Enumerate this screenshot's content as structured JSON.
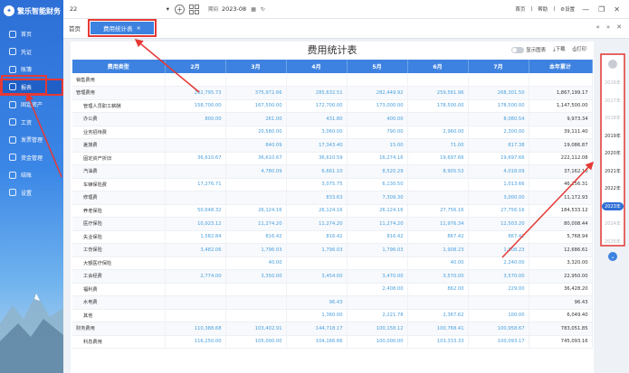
{
  "brand": {
    "name": "繁乐智能财务"
  },
  "sidebar": {
    "items": [
      {
        "label": "首页",
        "icon": "home-icon"
      },
      {
        "label": "凭证",
        "icon": "voucher-icon"
      },
      {
        "label": "账簿",
        "icon": "ledger-icon"
      },
      {
        "label": "报表",
        "icon": "report-icon"
      },
      {
        "label": "固定资产",
        "icon": "asset-icon"
      },
      {
        "label": "工资",
        "icon": "salary-icon"
      },
      {
        "label": "发票管理",
        "icon": "invoice-icon"
      },
      {
        "label": "资金管理",
        "icon": "fund-icon"
      },
      {
        "label": "结账",
        "icon": "close-books-icon"
      },
      {
        "label": "设置",
        "icon": "settings-icon"
      }
    ],
    "active_index": 3
  },
  "topbar": {
    "account": "22",
    "period_label": "期间",
    "period_value": "2023-08",
    "links": [
      "首页",
      "帮助",
      "设置"
    ]
  },
  "tabs": {
    "home": "首页",
    "active": "费用统计表",
    "close": "×"
  },
  "report": {
    "title": "费用统计表",
    "show_chart": "显示图表",
    "download": "下载",
    "print": "打印",
    "headers": [
      "费用类型",
      "2月",
      "3月",
      "4月",
      "5月",
      "6月",
      "7月",
      "本年累计"
    ],
    "rows": [
      {
        "name": "销售费用",
        "child": false,
        "cells": [
          "",
          "",
          "",
          "",
          "",
          "",
          ""
        ]
      },
      {
        "name": "管理费用",
        "child": false,
        "cells": [
          "262,795.73",
          "375,972.66",
          "285,632.51",
          "282,449.92",
          "259,561.96",
          "268,301.50",
          "1,867,199.17"
        ]
      },
      {
        "name": "管理人员职工薪酬",
        "child": true,
        "cells": [
          "158,700.00",
          "167,500.00",
          "172,700.00",
          "173,000.00",
          "178,500.00",
          "178,500.00",
          "1,147,500.00"
        ]
      },
      {
        "name": "办公费",
        "child": true,
        "cells": [
          "800.00",
          "261.00",
          "431.80",
          "400.00",
          "",
          "8,080.54",
          "9,973.34"
        ]
      },
      {
        "name": "业务招待费",
        "child": true,
        "cells": [
          "",
          "20,580.00",
          "3,060.00",
          "790.00",
          "2,960.00",
          "2,300.00",
          "39,111.40"
        ]
      },
      {
        "name": "差旅费",
        "child": true,
        "cells": [
          "",
          "840.09",
          "17,343.40",
          "15.00",
          "71.00",
          "817.38",
          "19,086.87"
        ]
      },
      {
        "name": "固定资产折旧",
        "child": true,
        "cells": [
          "36,610.67",
          "36,610.67",
          "36,610.59",
          "16,274.16",
          "19,697.66",
          "19,697.66",
          "222,112.08"
        ]
      },
      {
        "name": "汽油费",
        "child": true,
        "cells": [
          "",
          "4,780.09",
          "6,661.10",
          "8,520.29",
          "8,905.53",
          "4,018.09",
          "37,162.10"
        ]
      },
      {
        "name": "车辆保险费",
        "child": true,
        "cells": [
          "17,276.71",
          "",
          "3,075.75",
          "6,130.50",
          "",
          "1,013.66",
          "46,256.31"
        ]
      },
      {
        "name": "修理费",
        "child": true,
        "cells": [
          "",
          "",
          "833.63",
          "7,309.30",
          "",
          "3,000.00",
          "11,172.93"
        ]
      },
      {
        "name": "养老保险",
        "child": true,
        "cells": [
          "50,648.32",
          "26,124.16",
          "26,124.16",
          "26,124.16",
          "27,756.16",
          "27,756.16",
          "184,533.12"
        ]
      },
      {
        "name": "医疗保险",
        "child": true,
        "cells": [
          "10,923.12",
          "11,274.20",
          "11,274.20",
          "11,274.20",
          "11,976.34",
          "12,503.20",
          "80,008.44"
        ]
      },
      {
        "name": "失业保险",
        "child": true,
        "cells": [
          "1,582.84",
          "816.42",
          "816.42",
          "816.42",
          "867.42",
          "867.42",
          "5,768.94"
        ]
      },
      {
        "name": "工伤保险",
        "child": true,
        "cells": [
          "3,482.06",
          "1,796.03",
          "1,796.03",
          "1,796.03",
          "1,908.23",
          "1,908.23",
          "12,686.61"
        ]
      },
      {
        "name": "大额医疗保险",
        "child": true,
        "cells": [
          "",
          "40.00",
          "",
          "",
          "40.00",
          "2,240.00",
          "3,320.00"
        ]
      },
      {
        "name": "工会经费",
        "child": true,
        "cells": [
          "2,774.00",
          "3,350.00",
          "3,454.00",
          "3,470.00",
          "3,570.00",
          "3,570.00",
          "22,950.00"
        ]
      },
      {
        "name": "福利费",
        "child": true,
        "cells": [
          "",
          "",
          "",
          "2,408.00",
          "862.00",
          "229.00",
          "36,428.20"
        ]
      },
      {
        "name": "水电费",
        "child": true,
        "cells": [
          "",
          "",
          "96.43",
          "",
          "",
          "",
          "96.43"
        ]
      },
      {
        "name": "其他",
        "child": true,
        "cells": [
          "",
          "",
          "1,360.00",
          "2,221.78",
          "2,367.62",
          "100.00",
          "6,049.40"
        ]
      },
      {
        "name": "财务费用",
        "child": false,
        "cells": [
          "110,388.68",
          "103,402.91",
          "144,718.17",
          "100,158.12",
          "100,768.41",
          "100,958.67",
          "783,051.85"
        ]
      },
      {
        "name": "利息费用",
        "child": true,
        "cells": [
          "116,250.00",
          "105,000.00",
          "104,166.66",
          "100,000.00",
          "103,333.33",
          "100,093.17",
          "745,093.16"
        ]
      }
    ]
  },
  "years": {
    "items": [
      "2016年",
      "2017年",
      "2018年",
      "2019年",
      "2020年",
      "2021年",
      "2022年",
      "2023年",
      "2024年",
      "2025年"
    ],
    "dark": [
      "2019年",
      "2020年",
      "2021年",
      "2022年"
    ],
    "active": "2023年"
  },
  "colors": {
    "accent": "#3d82e0",
    "highlight": "#e53935"
  }
}
